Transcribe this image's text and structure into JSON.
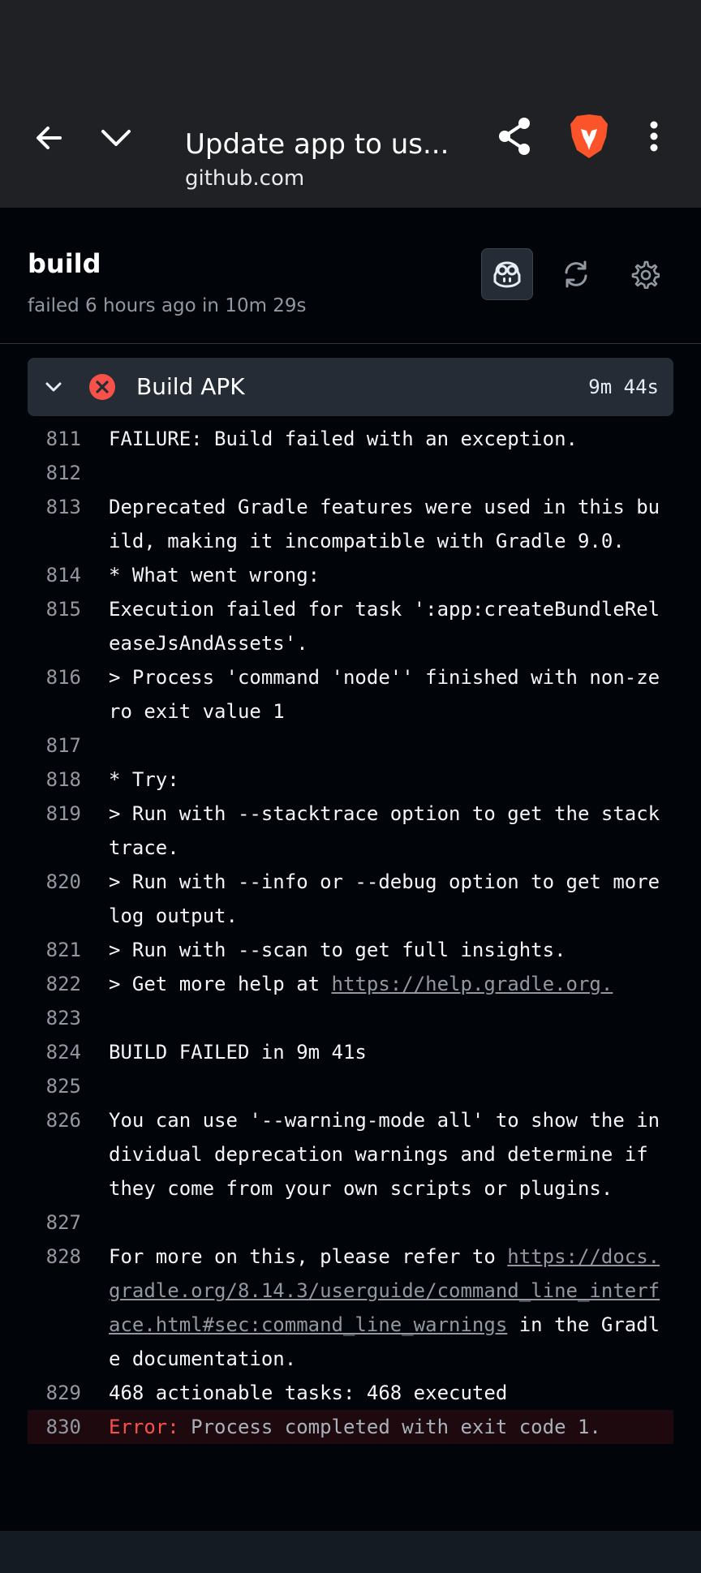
{
  "browser": {
    "tab_title": "Update app to us...",
    "url": "github.com"
  },
  "job": {
    "title": "build",
    "status": "failed 6 hours ago in 10m 29s"
  },
  "step": {
    "name": "Build APK",
    "duration": "9m 44s"
  },
  "log": [
    {
      "num": "811",
      "text": "FAILURE: Build failed with an exception."
    },
    {
      "num": "812",
      "text": ""
    },
    {
      "num": "813",
      "text": "Deprecated Gradle features were used in this build, making it incompatible with Gradle 9.0."
    },
    {
      "num": "814",
      "text": "* What went wrong:"
    },
    {
      "num": "815",
      "text": "Execution failed for task ':app:createBundleReleaseJsAndAssets'."
    },
    {
      "num": "816",
      "text": "> Process 'command 'node'' finished with non-zero exit value 1"
    },
    {
      "num": "817",
      "text": ""
    },
    {
      "num": "818",
      "text": "* Try:"
    },
    {
      "num": "819",
      "text": "> Run with --stacktrace option to get the stack trace."
    },
    {
      "num": "820",
      "text": "> Run with --info or --debug option to get more log output."
    },
    {
      "num": "821",
      "text": "> Run with --scan to get full insights."
    },
    {
      "num": "822",
      "text_before": "> Get more help at ",
      "link": "https://help.gradle.org."
    },
    {
      "num": "823",
      "text": ""
    },
    {
      "num": "824",
      "text": "BUILD FAILED in 9m 41s"
    },
    {
      "num": "825",
      "text": ""
    },
    {
      "num": "826",
      "text": "You can use '--warning-mode all' to show the individual deprecation warnings and determine if they come from your own scripts or plugins."
    },
    {
      "num": "827",
      "text": ""
    },
    {
      "num": "828",
      "text_before": "For more on this, please refer to ",
      "link": "https://docs.gradle.org/8.14.3/userguide/command_line_interface.html#sec:command_line_warnings",
      "text_after": " in the Gradle documentation."
    },
    {
      "num": "829",
      "text": "468 actionable tasks: 468 executed"
    },
    {
      "num": "830",
      "error_label": "Error:",
      "error_msg": " Process completed with exit code 1."
    }
  ],
  "icons": {
    "back": "arrow-left-icon",
    "collapse": "chevron-down-icon",
    "share": "share-icon",
    "brave": "brave-lion-icon",
    "menu": "more-vertical-icon",
    "copilot": "copilot-icon",
    "rerun": "sync-icon",
    "settings": "gear-icon",
    "step_toggle": "chevron-down-icon",
    "step_status": "x-circle-fill-icon"
  },
  "colors": {
    "error": "#f85149",
    "background": "#010409",
    "step_header": "#262c36",
    "brave_orange": "#fb542b"
  }
}
